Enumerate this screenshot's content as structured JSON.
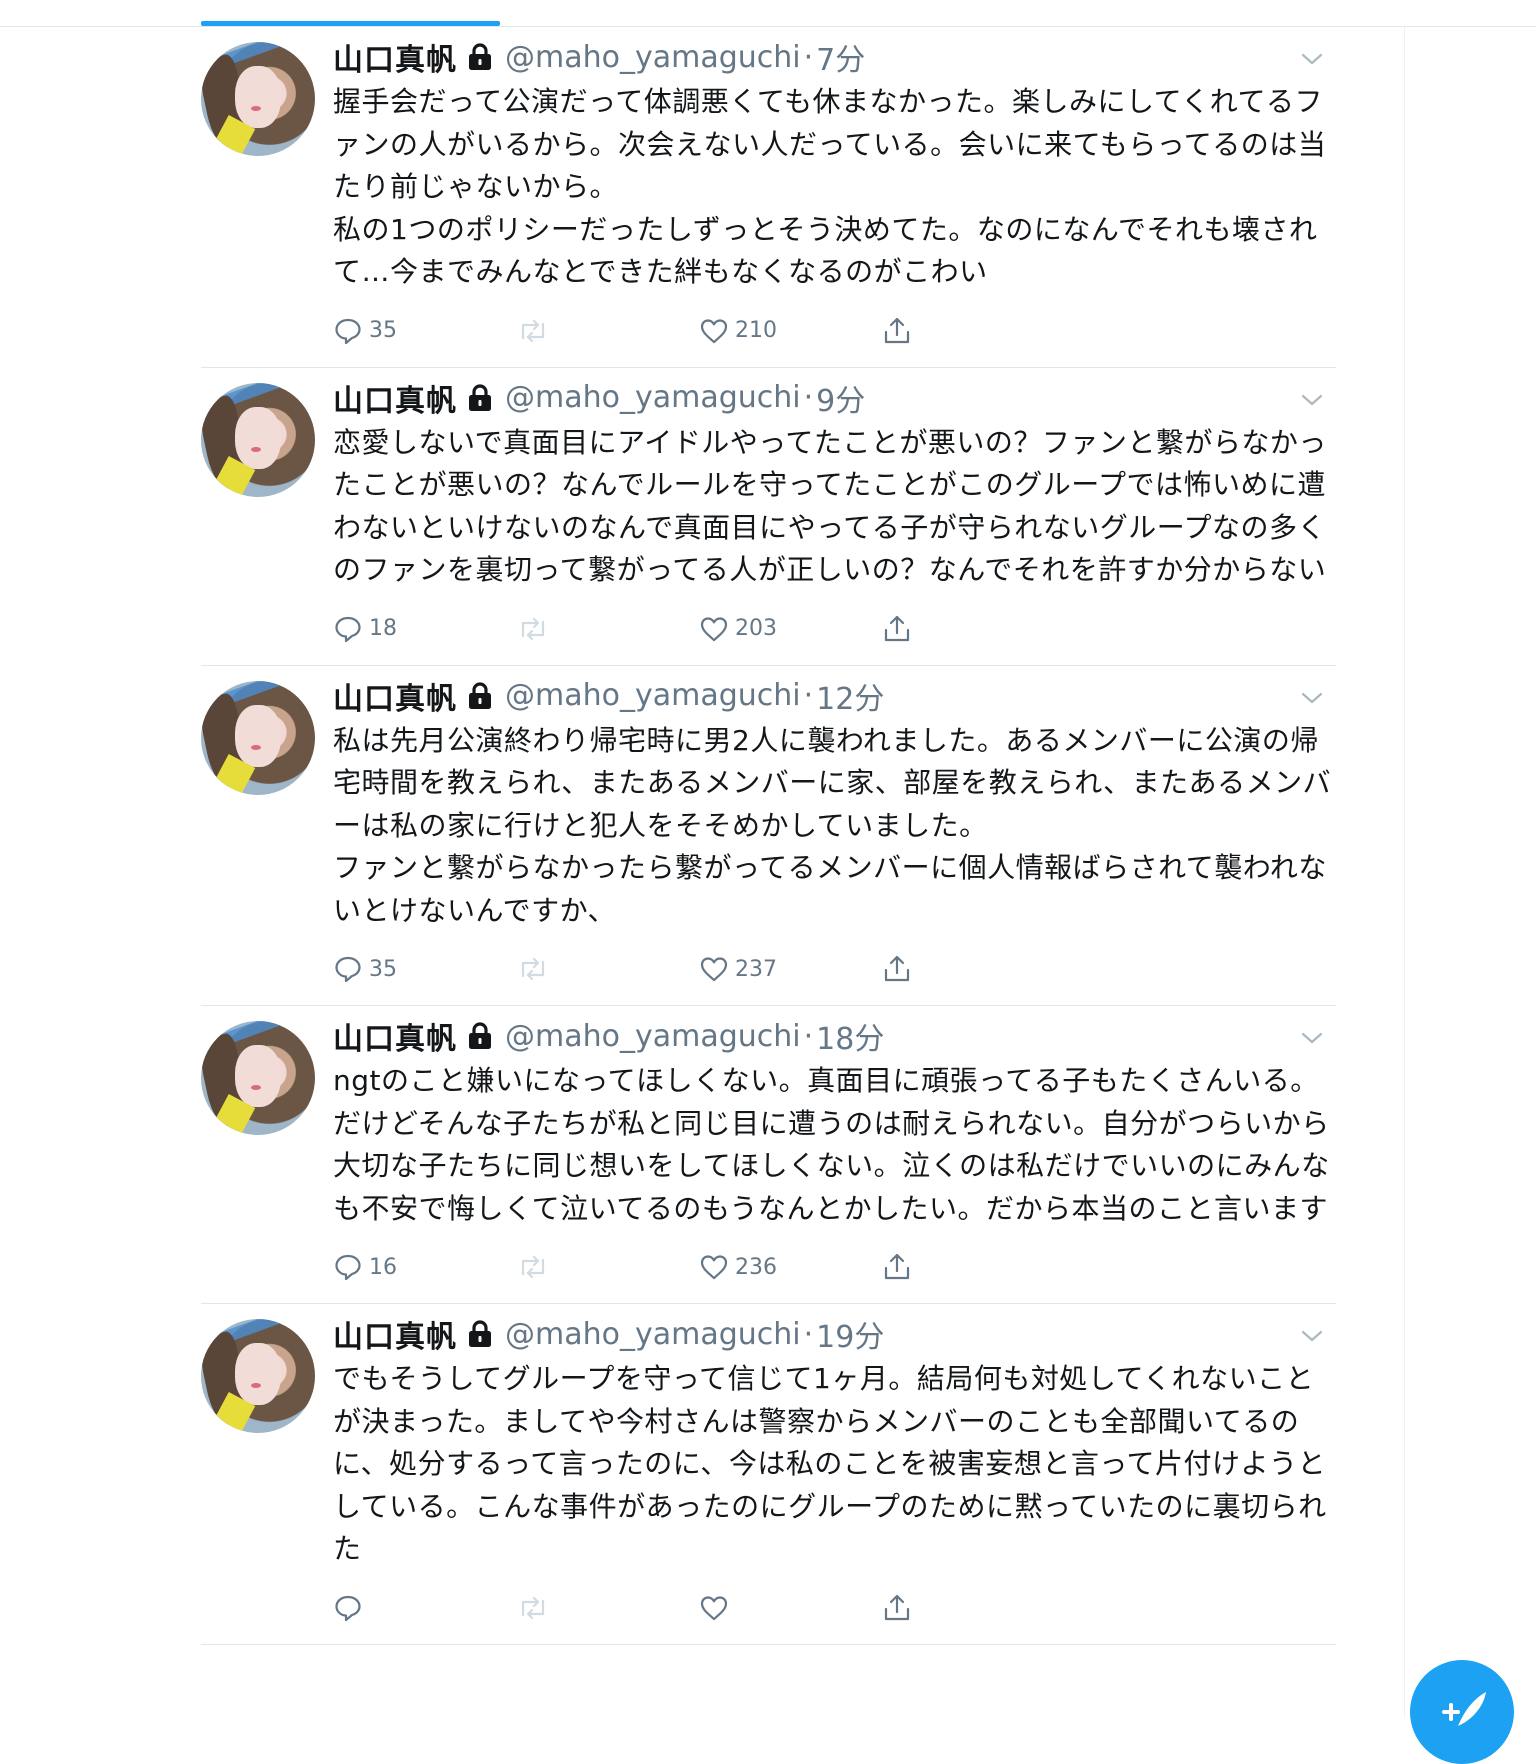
{
  "colors": {
    "accent": "#1da1f2",
    "text_primary": "#14171a",
    "text_secondary": "#657786",
    "divider": "#e1e8ed"
  },
  "tweets": [
    {
      "name": "山口真帆",
      "handle": "@maho_yamaguchi",
      "separator": "·",
      "time": "7分",
      "text": "握手会だって公演だって体調悪くても休まなかった。楽しみにしてくれてるファンの人がいるから。次会えない人だっている。会いに来てもらってるのは当たり前じゃないから。\n私の1つのポリシーだったしずっとそう決めてた。なのになんでそれも壊されて…今までみんなとできた絆もなくなるのがこわい",
      "replies": "35",
      "likes": "210"
    },
    {
      "name": "山口真帆",
      "handle": "@maho_yamaguchi",
      "separator": "·",
      "time": "9分",
      "text": "恋愛しないで真面目にアイドルやってたことが悪いの？ファンと繋がらなかったことが悪いの？なんでルールを守ってたことがこのグループでは怖いめに遭わないといけないのなんで真面目にやってる子が守られないグループなの多くのファンを裏切って繋がってる人が正しいの？なんでそれを許すか分からない",
      "replies": "18",
      "likes": "203"
    },
    {
      "name": "山口真帆",
      "handle": "@maho_yamaguchi",
      "separator": "·",
      "time": "12分",
      "text": "私は先月公演終わり帰宅時に男2人に襲われました。あるメンバーに公演の帰宅時間を教えられ、またあるメンバーに家、部屋を教えられ、またあるメンバーは私の家に行けと犯人をそそめかしていました。\nファンと繋がらなかったら繋がってるメンバーに個人情報ばらされて襲われないとけないんですか、",
      "replies": "35",
      "likes": "237"
    },
    {
      "name": "山口真帆",
      "handle": "@maho_yamaguchi",
      "separator": "·",
      "time": "18分",
      "text": "ngtのこと嫌いになってほしくない。真面目に頑張ってる子もたくさんいる。\nだけどそんな子たちが私と同じ目に遭うのは耐えられない。自分がつらいから大切な子たちに同じ想いをしてほしくない。泣くのは私だけでいいのにみんなも不安で悔しくて泣いてるのもうなんとかしたい。だから本当のこと言います",
      "replies": "16",
      "likes": "236"
    },
    {
      "name": "山口真帆",
      "handle": "@maho_yamaguchi",
      "separator": "·",
      "time": "19分",
      "text": "でもそうしてグループを守って信じて1ヶ月。結局何も対処してくれないことが決まった。ましてや今村さんは警察からメンバーのことも全部聞いてるのに、処分するって言ったのに、今は私のことを被害妄想と言って片付けようとしている。こんな事件があったのにグループのために黙っていたのに裏切られた",
      "replies": "",
      "likes": ""
    }
  ]
}
